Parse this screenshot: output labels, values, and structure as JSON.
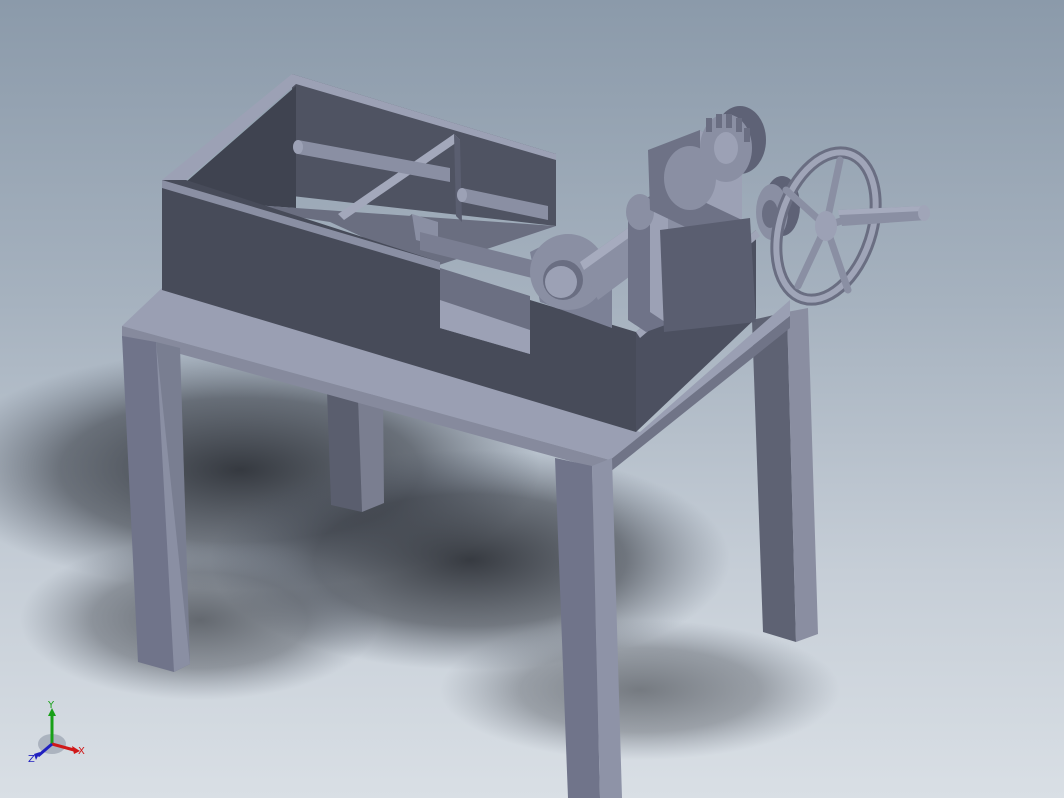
{
  "viewport": {
    "background_top": "#8b9aaa",
    "background_bottom": "#d9dfe5",
    "model_color": "#7e8196",
    "model_dark": "#464a58",
    "model_light": "#9aa0b5"
  },
  "triad": {
    "x_label": "X",
    "y_label": "Y",
    "z_label": "Z",
    "x_color": "#d01818",
    "y_color": "#18a018",
    "z_color": "#2020c0"
  }
}
